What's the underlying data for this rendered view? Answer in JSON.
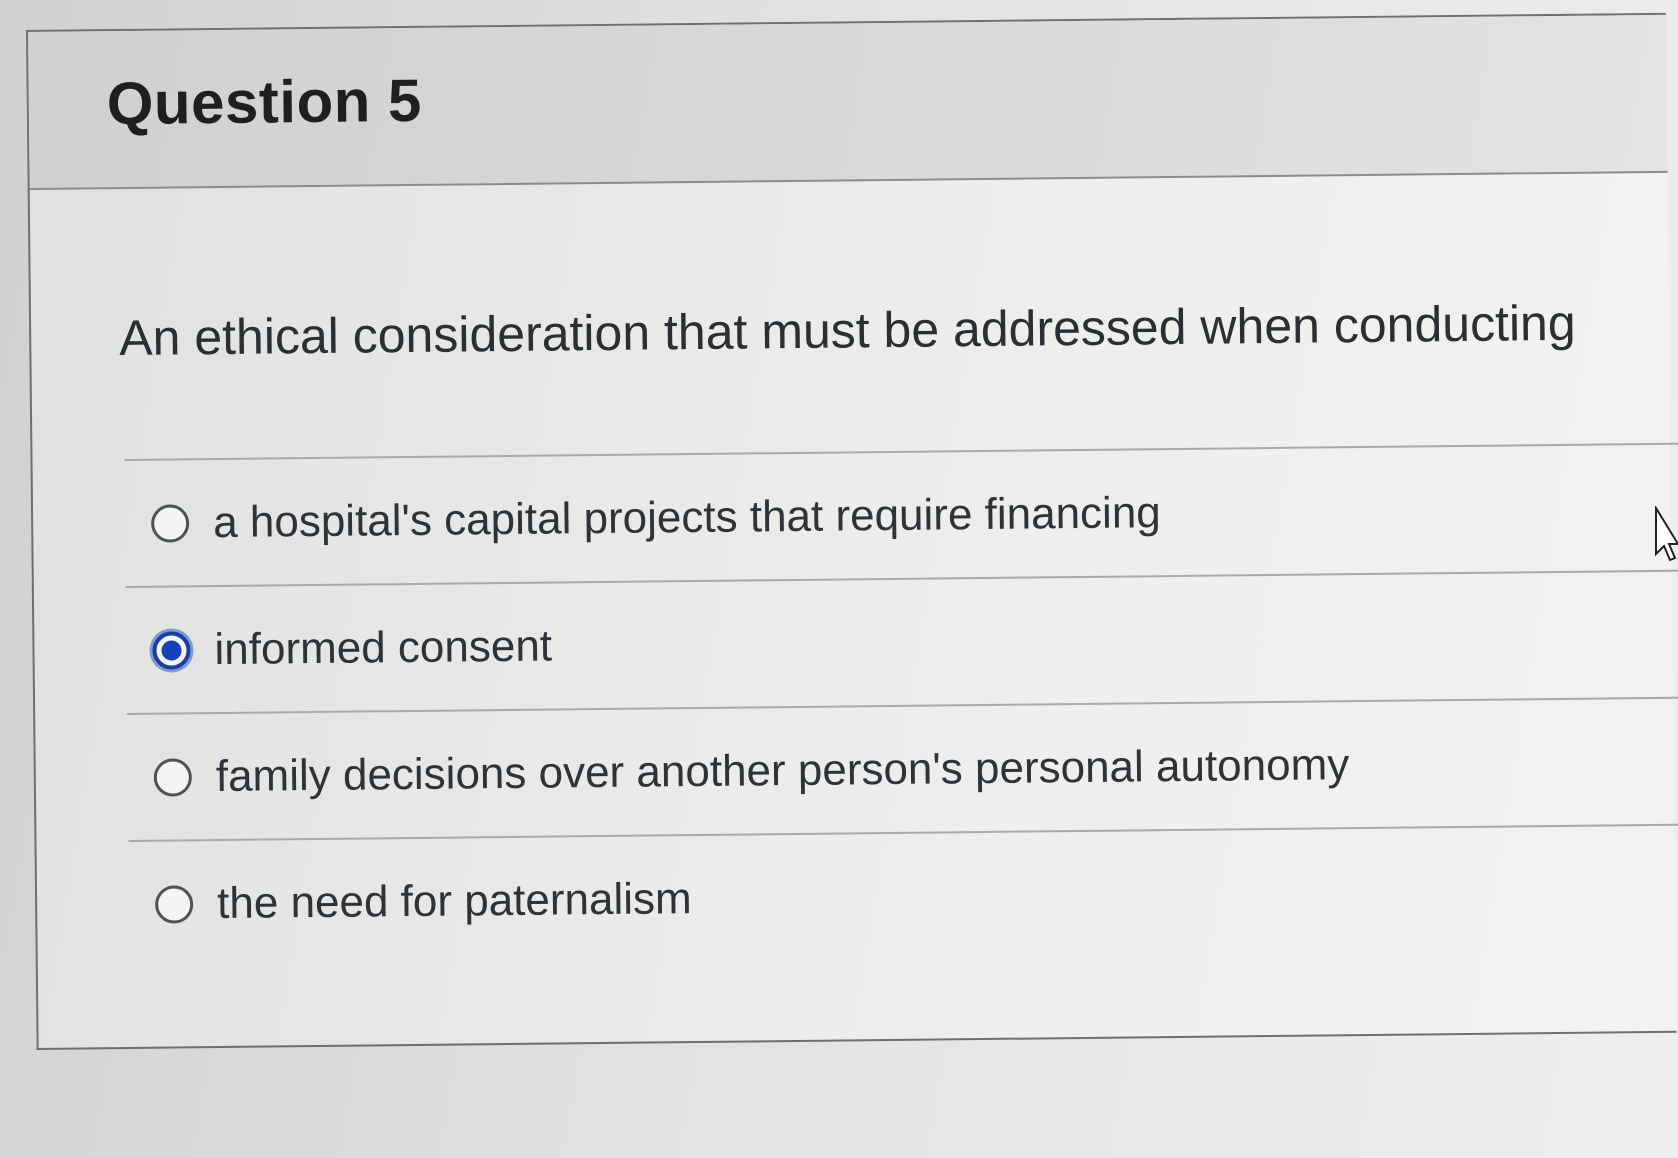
{
  "question": {
    "title": "Question 5",
    "text": "An ethical consideration that must be addressed when conducting",
    "answers": [
      {
        "label": "a hospital's capital projects that require financing",
        "selected": false
      },
      {
        "label": "informed consent",
        "selected": true
      },
      {
        "label": "family decisions over another person's personal autonomy",
        "selected": false
      },
      {
        "label": "the need for paternalism",
        "selected": false
      }
    ]
  },
  "colors": {
    "selected_radio": "#1741b8",
    "header_background": "#d6d8d6",
    "text": "#2d3b45"
  },
  "icons": {
    "cursor": "mouse-pointer-icon"
  }
}
